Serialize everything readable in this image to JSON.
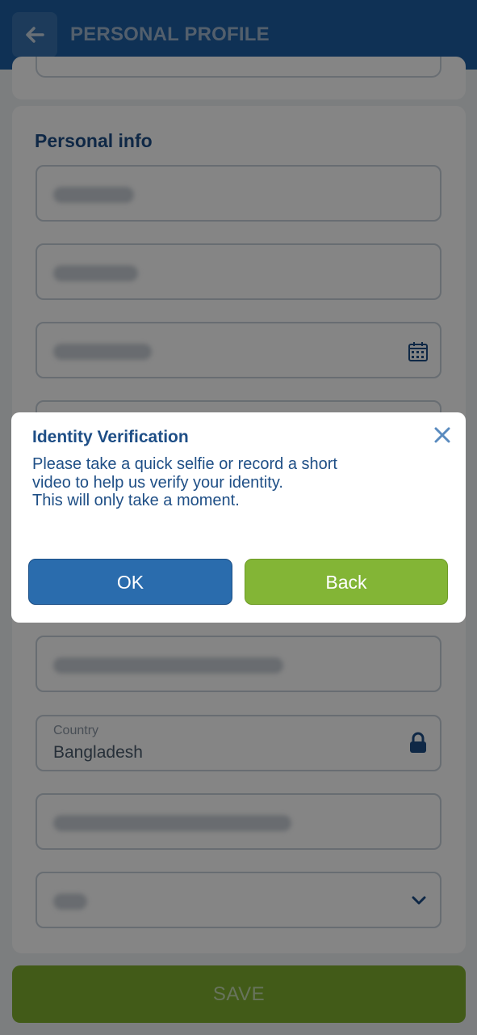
{
  "header": {
    "title": "PERSONAL PROFILE",
    "back_icon": "arrow-left-icon",
    "background": "#1d5fa3"
  },
  "personal_info": {
    "title": "Personal info",
    "country": {
      "label": "Country",
      "value": "Bangladesh",
      "icon": "lock-icon"
    },
    "date_field_icon": "calendar-icon",
    "select_icon": "chevron-down-icon"
  },
  "save_button": {
    "label": "SAVE",
    "color": "#7fae2f"
  },
  "dialog": {
    "title": "Identity Verification",
    "message": "Please take a quick selfie or record a short\nvideo to help us verify your identity.\nThis will only take a moment.",
    "ok_label": "OK",
    "back_label": "Back",
    "close_icon": "close-icon",
    "ok_color": "#2a6cad",
    "back_color": "#83b536"
  }
}
